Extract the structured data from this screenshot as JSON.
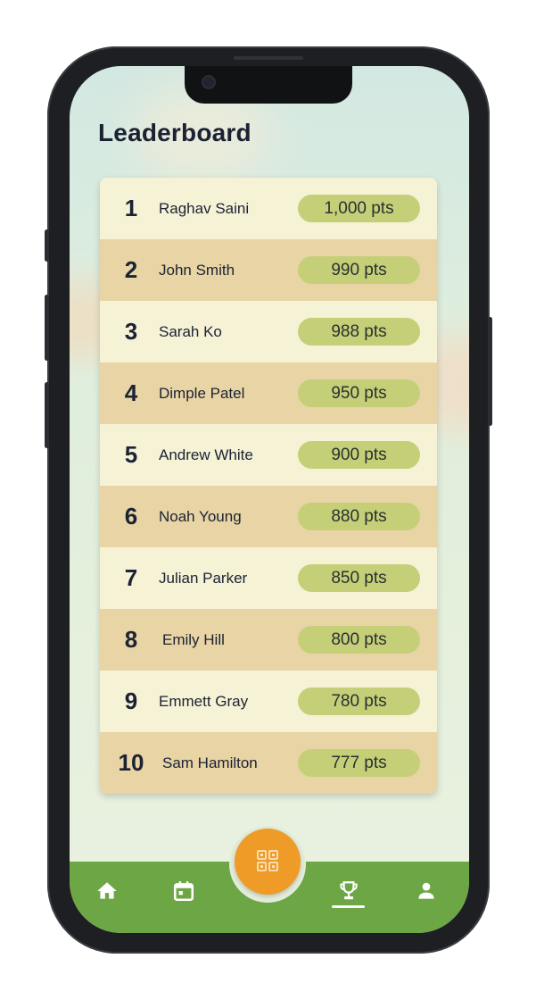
{
  "header": {
    "title": "Leaderboard"
  },
  "leaderboard": [
    {
      "rank": "1",
      "name": "Raghav Saini",
      "points": "1,000 pts"
    },
    {
      "rank": "2",
      "name": "John Smith",
      "points": "990 pts"
    },
    {
      "rank": "3",
      "name": "Sarah Ko",
      "points": "988 pts"
    },
    {
      "rank": "4",
      "name": "Dimple Patel",
      "points": "950 pts"
    },
    {
      "rank": "5",
      "name": "Andrew White",
      "points": "900 pts"
    },
    {
      "rank": "6",
      "name": "Noah Young",
      "points": "880 pts"
    },
    {
      "rank": "7",
      "name": "Julian Parker",
      "points": "850 pts"
    },
    {
      "rank": "8",
      "name": "Emily Hill",
      "points": "800 pts"
    },
    {
      "rank": "9",
      "name": "Emmett Gray",
      "points": "780 pts"
    },
    {
      "rank": "10",
      "name": "Sam Hamilton",
      "points": "777 pts"
    }
  ],
  "nav": {
    "items": [
      {
        "icon": "home-icon",
        "active": false
      },
      {
        "icon": "calendar-icon",
        "active": false
      },
      {
        "icon": "qr-code-icon",
        "active": false
      },
      {
        "icon": "trophy-icon",
        "active": true
      },
      {
        "icon": "profile-icon",
        "active": false
      }
    ]
  },
  "colors": {
    "accent": "#ef9b27",
    "navbar": "#6ca645",
    "row_light": "#f6f2d6",
    "row_dark": "#e8d4a4",
    "points_pill": "#c5cf78"
  }
}
